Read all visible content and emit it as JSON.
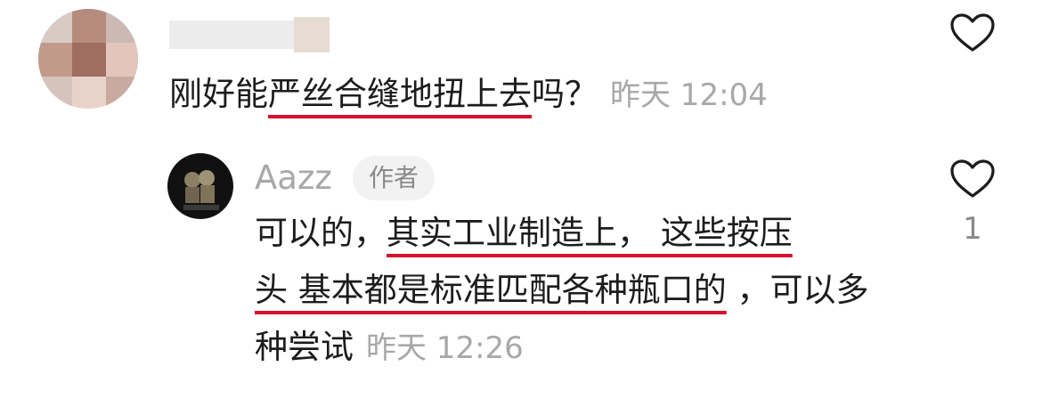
{
  "comments": [
    {
      "text": "刚好能严丝合缝地扭上去吗？",
      "text_plain_prefix": "刚好能",
      "text_underlined": "严丝合缝地扭上去",
      "text_suffix": "吗？",
      "time": "昨天 12:04"
    }
  ],
  "reply": {
    "username": "Aazz",
    "author_tag": "作者",
    "text_part1": "可以的，",
    "text_underlined": "其实工业制造上， 这些按压头 基本都是标准匹配各种瓶口的",
    "text_ul_a": "其实工业制造上， 这些按压",
    "text_ul_b": "头 基本都是标准匹配各种瓶口的",
    "text_part2": " ，可以多种尝试",
    "time": "昨天 12:26",
    "like_count": "1"
  },
  "icons": {
    "heart": "heart-outline-icon"
  },
  "colors": {
    "underline": "#d7112d",
    "time": "#a8a8a8",
    "text": "#1c1c1c"
  }
}
